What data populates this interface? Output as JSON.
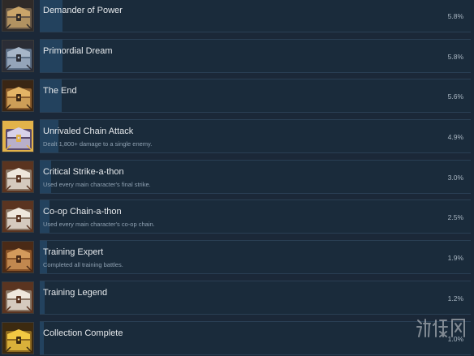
{
  "achievements": [
    {
      "title": "Demander of Power",
      "description": "",
      "percent": "5.8%",
      "fill": 0.052,
      "icon_name": "chest-gold-icon",
      "icon_palette": [
        "#6a5a48",
        "#caa56a",
        "#2f2a28"
      ]
    },
    {
      "title": "Primordial Dream",
      "description": "",
      "percent": "5.8%",
      "fill": 0.052,
      "icon_name": "chest-blue-icon",
      "icon_palette": [
        "#5d6f86",
        "#a7b6c9",
        "#2b2d36"
      ]
    },
    {
      "title": "The End",
      "description": "",
      "percent": "5.6%",
      "fill": 0.05,
      "icon_name": "chest-gold-icon",
      "icon_palette": [
        "#8c5e2d",
        "#e3b466",
        "#3a2614"
      ]
    },
    {
      "title": "Unrivaled Chain Attack",
      "description": "Dealt 1,800+ damage to a single enemy.",
      "percent": "4.9%",
      "fill": 0.044,
      "icon_name": "chain-attack-icon",
      "icon_palette": [
        "#5a4a6e",
        "#d8d2ea",
        "#e2b34a"
      ]
    },
    {
      "title": "Critical Strike-a-thon",
      "description": "Used every main character's final strike.",
      "percent": "3.0%",
      "fill": 0.027,
      "icon_name": "chest-silver-icon",
      "icon_palette": [
        "#8a7665",
        "#eee7dc",
        "#5a3420"
      ]
    },
    {
      "title": "Co-op Chain-a-thon",
      "description": "Used every main character's co-op chain.",
      "percent": "2.5%",
      "fill": 0.022,
      "icon_name": "chest-silver-icon",
      "icon_palette": [
        "#8a7665",
        "#eee7dc",
        "#5a3420"
      ]
    },
    {
      "title": "Training Expert",
      "description": "Completed all training battles.",
      "percent": "1.9%",
      "fill": 0.017,
      "icon_name": "chest-bronze-icon",
      "icon_palette": [
        "#8a5428",
        "#d39a5c",
        "#4a2a16"
      ]
    },
    {
      "title": "Training Legend",
      "description": "",
      "percent": "1.2%",
      "fill": 0.011,
      "icon_name": "chest-silver-icon",
      "icon_palette": [
        "#8a7665",
        "#eee7dc",
        "#5a3420"
      ]
    },
    {
      "title": "Collection Complete",
      "description": "",
      "percent": "1.0%",
      "fill": 0.009,
      "icon_name": "chest-yellow-icon",
      "icon_palette": [
        "#8e6a20",
        "#f1c843",
        "#3c2a10"
      ]
    }
  ],
  "watermark": {
    "text": "游侠网",
    "color": "#d5d7da"
  },
  "colors": {
    "background": "#1b2838",
    "bar": "#1a2b3b",
    "fill": "#23425e",
    "title": "#e6e9ec",
    "desc": "#8fa1b2",
    "percent": "#a9b6c2"
  }
}
